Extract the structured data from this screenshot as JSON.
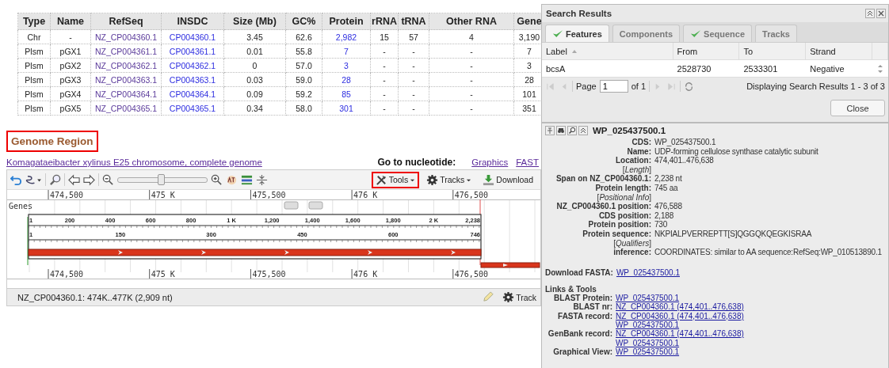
{
  "table": {
    "columns": [
      {
        "label": "Type",
        "kind": "text"
      },
      {
        "label": "Name",
        "kind": "text"
      },
      {
        "label": "RefSeq",
        "kind": "link"
      },
      {
        "label": "INSDC",
        "kind": "link"
      },
      {
        "label": "Size (Mb)",
        "kind": "text"
      },
      {
        "label": "GC%",
        "kind": "text"
      },
      {
        "label": "Protein",
        "kind": "link"
      },
      {
        "label": "rRNA",
        "kind": "text"
      },
      {
        "label": "tRNA",
        "kind": "text"
      },
      {
        "label": "Other RNA",
        "kind": "text"
      },
      {
        "label": "Gene",
        "kind": "text"
      }
    ],
    "rows": [
      {
        "cells": [
          "Chr",
          "-",
          "NZ_CP004360.1",
          "CP004360.1",
          "3.45",
          "62.6",
          "2,982",
          "15",
          "57",
          "4",
          "3,190"
        ]
      },
      {
        "cells": [
          "Plsm",
          "pGX1",
          "NZ_CP004361.1",
          "CP004361.1",
          "0.01",
          "55.8",
          "7",
          "-",
          "-",
          "-",
          "7"
        ]
      },
      {
        "cells": [
          "Plsm",
          "pGX2",
          "NZ_CP004362.1",
          "CP004362.1",
          "0",
          "57.0",
          "3",
          "-",
          "-",
          "-",
          "3"
        ]
      },
      {
        "cells": [
          "Plsm",
          "pGX3",
          "NZ_CP004363.1",
          "CP004363.1",
          "0.03",
          "59.0",
          "28",
          "-",
          "-",
          "-",
          "28"
        ]
      },
      {
        "cells": [
          "Plsm",
          "pGX4",
          "NZ_CP004364.1",
          "CP004364.1",
          "0.09",
          "59.2",
          "85",
          "-",
          "-",
          "-",
          "101"
        ]
      },
      {
        "cells": [
          "Plsm",
          "pGX5",
          "NZ_CP004365.1",
          "CP004365.1",
          "0.34",
          "58.0",
          "301",
          "-",
          "-",
          "-",
          "351"
        ]
      }
    ]
  },
  "genome_region": {
    "title": "Genome Region",
    "highlighted": true,
    "organism_link": "Komagataeibacter xylinus E25 chromosome, complete genome",
    "goto_label": "Go to nucleotide:",
    "goto_links": [
      "Graphics",
      "FAST"
    ]
  },
  "viewer": {
    "zoom": {
      "level": 0.48
    },
    "toolbar_buttons": [
      {
        "kind": "tools",
        "label": "Tools",
        "highlighted": true
      },
      {
        "kind": "tracks",
        "label": "Tracks",
        "highlighted": false
      },
      {
        "kind": "download",
        "label": "Download",
        "highlighted": false
      }
    ],
    "top_ruler": [
      "474,500",
      "475 K",
      "475,500",
      "476 K",
      "476,500"
    ],
    "track_label": "Genes",
    "nt_ticks": [
      "1",
      "200",
      "400",
      "600",
      "800",
      "1 K",
      "1,200",
      "1,400",
      "1,600",
      "1,800",
      "2 K",
      "2,238"
    ],
    "aa_ticks": [
      "1",
      "150",
      "300",
      "450",
      "600",
      "746"
    ],
    "bottom_ruler": [
      "474,500",
      "475 K",
      "475,500",
      "476 K",
      "476,500"
    ],
    "status": "NZ_CP004360.1: 474K..477K (2,909 nt)",
    "status_tracks": "Track"
  },
  "search_results": {
    "title": "Search Results",
    "tabs": [
      {
        "label": "Features",
        "checked": true,
        "selected": true
      },
      {
        "label": "Components",
        "checked": false,
        "selected": false
      },
      {
        "label": "Sequence",
        "checked": true,
        "selected": false
      },
      {
        "label": "Tracks",
        "checked": false,
        "selected": false
      }
    ],
    "columns": [
      "Label",
      "From",
      "To",
      "Strand"
    ],
    "rows": [
      [
        "bcsA",
        "2528730",
        "2533301",
        "Negative"
      ]
    ],
    "page_label": "Page",
    "page": "1",
    "page_of": "of 1",
    "display": "Displaying Search Results 1 - 3 of 3",
    "close": "Close"
  },
  "details": {
    "title": "WP_025437500.1",
    "fields": [
      {
        "kind": "field",
        "label": "CDS:",
        "value": "WP_025437500.1"
      },
      {
        "kind": "field",
        "label": "Name:",
        "value": "UDP-forming cellulose synthase catalytic subunit"
      },
      {
        "kind": "field",
        "label": "Location:",
        "value": "474,401..476,638"
      },
      {
        "kind": "section",
        "label": "[*Length*]"
      },
      {
        "kind": "field",
        "label": "Span on NZ_CP004360.1:",
        "value": "2,238 nt"
      },
      {
        "kind": "field",
        "label": "Protein length:",
        "value": "745 aa"
      },
      {
        "kind": "section",
        "label": "[*Positional Info*]"
      },
      {
        "kind": "field",
        "label": "NZ_CP004360.1 position:",
        "value": "476,588"
      },
      {
        "kind": "field",
        "label": "CDS position:",
        "value": "2,188"
      },
      {
        "kind": "field",
        "label": "Protein position:",
        "value": "730"
      },
      {
        "kind": "field",
        "label": "Protein sequence:",
        "value": "NKPIALPVERREPTT[S]QGGQKQEGKISRAA"
      },
      {
        "kind": "section",
        "label": "[*Qualifiers*]"
      },
      {
        "kind": "field",
        "label": "inference:",
        "value": "COORDINATES: similar to AA sequence:RefSeq:WP_010513890.1"
      }
    ],
    "download_label": "Download FASTA:",
    "download_link": "WP_025437500.1",
    "links_title": "Links & Tools",
    "links": [
      {
        "label": "BLAST Protein:",
        "links": [
          "WP_025437500.1"
        ]
      },
      {
        "label": "BLAST nr:",
        "links": [
          "NZ_CP004360.1 (474,401..476,638)"
        ]
      },
      {
        "label": "FASTA record:",
        "links": [
          "NZ_CP004360.1 (474,401..476,638)",
          "WP_025437500.1"
        ]
      },
      {
        "label": "GenBank record:",
        "links": [
          "NZ_CP004360.1 (474,401..476,638)",
          "WP_025437500.1"
        ]
      },
      {
        "label": "Graphical View:",
        "links": [
          "WP_025437500.1"
        ]
      }
    ]
  }
}
